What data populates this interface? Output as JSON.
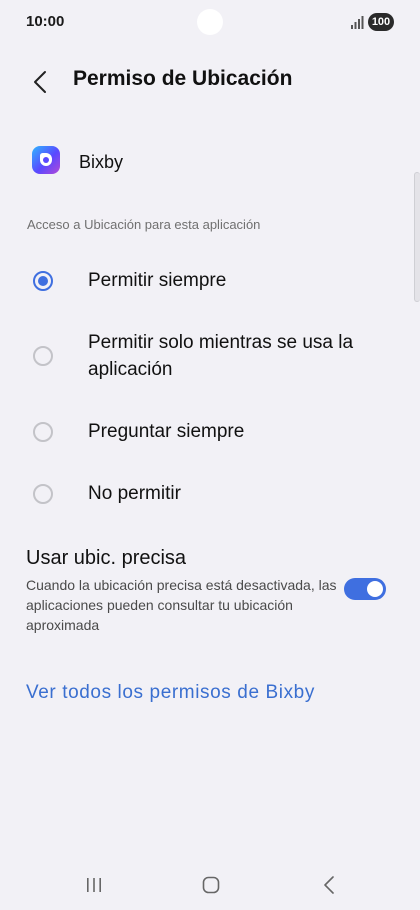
{
  "status_bar": {
    "time": "10:00",
    "battery": "100"
  },
  "header": {
    "title": "Permiso de Ubicación"
  },
  "app": {
    "name": "Bixby"
  },
  "section_label": "Acceso a Ubicación para esta aplicación",
  "options": [
    {
      "label": "Permitir siempre",
      "selected": true
    },
    {
      "label": "Permitir solo mientras se usa la aplicación",
      "selected": false
    },
    {
      "label": "Preguntar siempre",
      "selected": false
    },
    {
      "label": "No permitir",
      "selected": false
    }
  ],
  "precise_location": {
    "title": "Usar ubic. precisa",
    "description": "Cuando la ubicación precisa está desactivada, las aplicaciones pueden consultar tu ubicación aproximada",
    "enabled": true
  },
  "link": {
    "label": "Ver todos los permisos de Bixby"
  },
  "colors": {
    "accent": "#3f6fe0",
    "link": "#3a6fd0",
    "background": "#f2f1f6"
  },
  "icons": {
    "back": "chevron-left-icon",
    "recents": "recents-icon",
    "home": "home-icon",
    "nav_back": "back-icon"
  }
}
